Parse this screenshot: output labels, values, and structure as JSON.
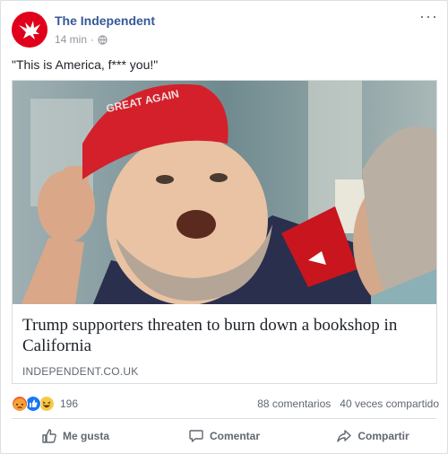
{
  "post": {
    "page_name": "The Independent",
    "time": "14 min",
    "separator": "·",
    "privacy_icon": "globe-icon",
    "more_label": "···",
    "status_text": "\"This is America, f*** you!\""
  },
  "link": {
    "headline": "Trump supporters threaten to burn down a bookshop in California",
    "domain": "INDEPENDENT.CO.UK",
    "image_cap_text": "GREAT AGAIN"
  },
  "reactions": {
    "icons": [
      "angry-icon",
      "like-icon",
      "haha-icon"
    ],
    "total": "196",
    "comments": "88 comentarios",
    "shares": "40 veces compartido"
  },
  "actions": {
    "like": "Me gusta",
    "comment": "Comentar",
    "share": "Compartir"
  },
  "colors": {
    "brand_link": "#365899",
    "independent_red": "#e0001b",
    "muted_text": "#606770"
  }
}
